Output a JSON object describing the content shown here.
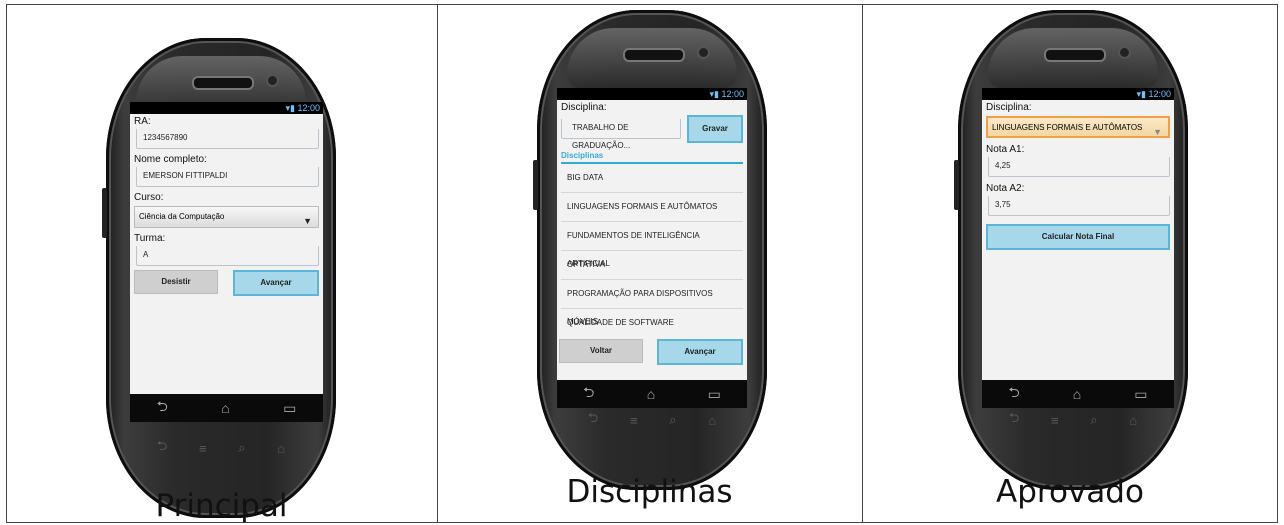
{
  "panels": [
    {
      "caption": "Principal"
    },
    {
      "caption": "Disciplinas"
    },
    {
      "caption": "Aprovado"
    }
  ],
  "statusbar": {
    "time": "12:00",
    "icons": "wifi-icon signal-icon battery-icon"
  },
  "navbar": {
    "back": "⮌",
    "home": "⌂",
    "recent": "▭"
  },
  "principal": {
    "ra_label": "RA:",
    "ra_value": "1234567890",
    "nome_label": "Nome completo:",
    "nome_value": "EMERSON FITTIPALDI",
    "curso_label": "Curso:",
    "curso_value": "Ciência da Computação",
    "turma_label": "Turma:",
    "turma_value": "A",
    "desistir_label": "Desistir",
    "avancar_label": "Avançar"
  },
  "disciplinas": {
    "disciplina_label": "Disciplina:",
    "disciplina_value": "TRABALHO DE GRADUAÇÃO...",
    "gravar_label": "Gravar",
    "list_header": "Disciplinas",
    "items": [
      "BIG DATA",
      "LINGUAGENS FORMAIS E AUTÔMATOS",
      "FUNDAMENTOS DE INTELIGÊNCIA ARTIFICIAL",
      "OPTATIVA",
      "PROGRAMAÇÃO PARA DISPOSITIVOS MÓVEIS",
      "QUALIDADE DE SOFTWARE"
    ],
    "voltar_label": "Voltar",
    "avancar_label": "Avançar"
  },
  "aprovado": {
    "disciplina_label": "Disciplina:",
    "disciplina_value": "LINGUAGENS FORMAIS E AUTÔMATOS",
    "nota_a1_label": "Nota A1:",
    "nota_a1_value": "4,25",
    "nota_a2_label": "Nota A2:",
    "nota_a2_value": "3,75",
    "calcular_label": "Calcular Nota Final"
  },
  "colors": {
    "accent": "#33a9d6",
    "button_blue": "#a7d8ea",
    "spinner_focus": "#f0a040"
  }
}
